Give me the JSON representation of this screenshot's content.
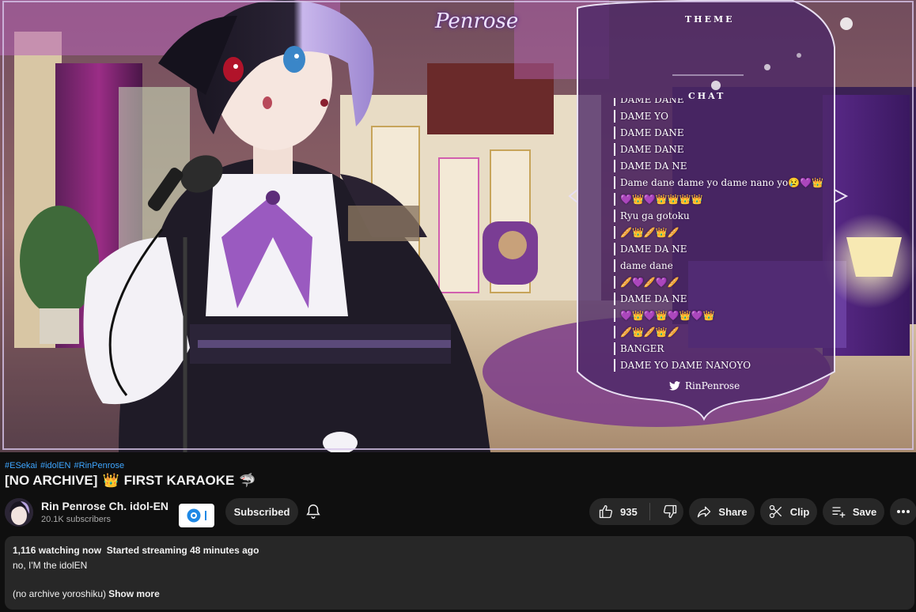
{
  "overlay": {
    "stream_logo_text": "Penrose",
    "theme_heading": "THEME",
    "chat_heading": "CHAT",
    "chat_messages": [
      "DAME DANE",
      "DAME YO",
      "DAME DANE",
      "DAME DANE",
      "DAME DA NE",
      "Dame dane dame yo dame nano yo😢💜👑",
      "💜👑💜👑👑👑👑",
      "Ryu ga gotoku",
      "🥖👑🥖👑🥖",
      "DAME DA NE",
      "dame dane",
      "🥖💜🥖💜🥖",
      "DAME DA NE",
      "💜👑💜👑💜👑💜👑",
      "🥖👑🥖👑🥖",
      "BANGER",
      "DAME YO DAME NANOYO"
    ],
    "twitter_handle": "RinPenrose"
  },
  "video": {
    "hashtags": [
      "#ESekai",
      "#idolEN",
      "#RinPenrose"
    ],
    "title_prefix": "[NO ARCHIVE]",
    "title_crown": "👑",
    "title_main": "FIRST KARAOKE",
    "title_shark": "🦈"
  },
  "channel": {
    "name": "Rin Penrose Ch. idol-EN",
    "subscribers": "20.1K subscribers",
    "subscribe_label": "Subscribed"
  },
  "actions": {
    "like_count": "935",
    "share_label": "Share",
    "clip_label": "Clip",
    "save_label": "Save"
  },
  "description": {
    "viewers": "1,116 watching now",
    "started": "Started streaming 48 minutes ago",
    "line1": "no, I'M the idolEN",
    "line2": "(no archive yoroshiku)",
    "show_more": "Show more"
  },
  "colors": {
    "page_bg": "#0f0f0f",
    "pill_bg": "#272727",
    "link": "#3ea6ff",
    "text": "#f1f1f1",
    "muted": "#aaaaaa"
  }
}
